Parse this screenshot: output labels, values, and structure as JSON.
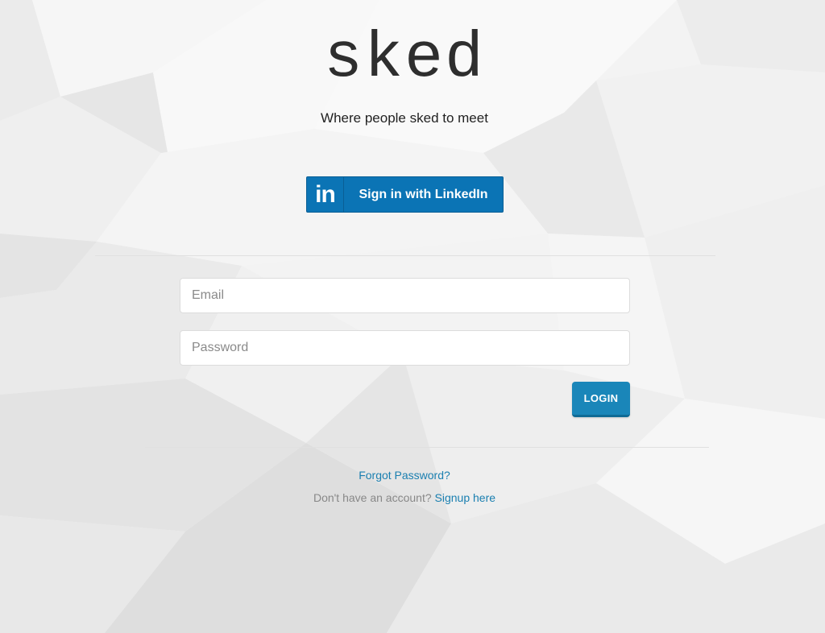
{
  "brand": {
    "logo_text": "sked",
    "tagline": "Where people sked to meet"
  },
  "linkedin": {
    "icon_text": "in",
    "label": "Sign in with LinkedIn",
    "color": "#0b74b5"
  },
  "form": {
    "email_placeholder": "Email",
    "password_placeholder": "Password",
    "login_label": "LOGIN",
    "login_color": "#1a86b9"
  },
  "footer": {
    "forgot_label": "Forgot Password?",
    "no_account_text": "Don't have an account?",
    "signup_label": "Signup here",
    "link_color": "#1a7fb0"
  }
}
